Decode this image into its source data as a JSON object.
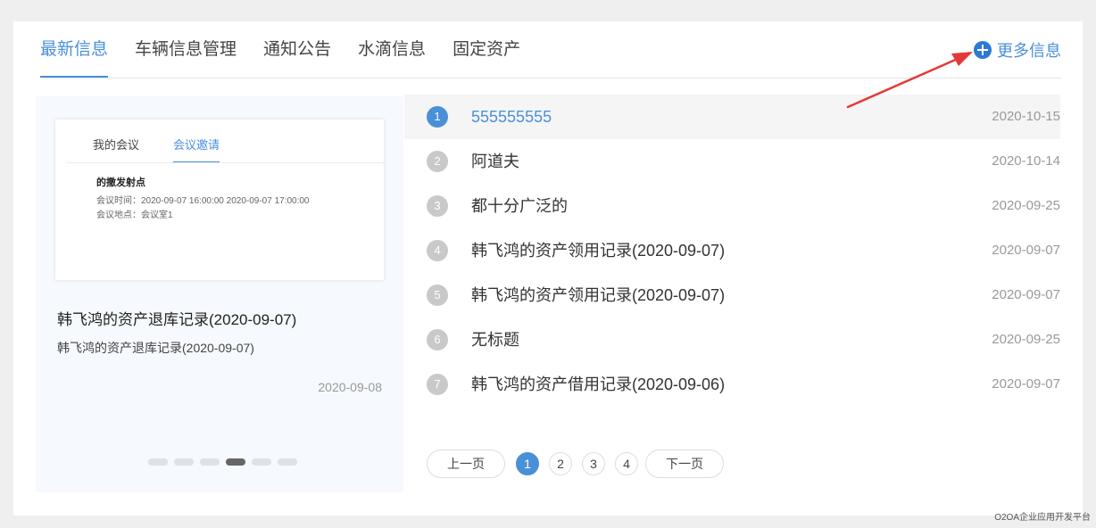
{
  "tabs": [
    {
      "label": "最新信息",
      "active": true
    },
    {
      "label": "车辆信息管理",
      "active": false
    },
    {
      "label": "通知公告",
      "active": false
    },
    {
      "label": "水滴信息",
      "active": false
    },
    {
      "label": "固定资产",
      "active": false
    }
  ],
  "more_label": "更多信息",
  "featured": {
    "preview": {
      "tab_my": "我的会议",
      "tab_invite": "会议邀请",
      "title": "的撒发射点",
      "time": "会议时间：2020-09-07 16:00:00 2020-09-07 17:00:00",
      "place": "会议地点：会议室1"
    },
    "title": "韩飞鸿的资产退库记录(2020-09-07)",
    "subtitle": "韩飞鸿的资产退库记录(2020-09-07)",
    "date": "2020-09-08",
    "slide_count": 6,
    "active_slide": 4
  },
  "items": [
    {
      "num": "1",
      "title": "555555555",
      "date": "2020-10-15"
    },
    {
      "num": "2",
      "title": "阿道夫",
      "date": "2020-10-14"
    },
    {
      "num": "3",
      "title": "都十分广泛的",
      "date": "2020-09-25"
    },
    {
      "num": "4",
      "title": "韩飞鸿的资产领用记录(2020-09-07)",
      "date": "2020-09-07"
    },
    {
      "num": "5",
      "title": "韩飞鸿的资产领用记录(2020-09-07)",
      "date": "2020-09-07"
    },
    {
      "num": "6",
      "title": "无标题",
      "date": "2020-09-25"
    },
    {
      "num": "7",
      "title": "韩飞鸿的资产借用记录(2020-09-06)",
      "date": "2020-09-07"
    }
  ],
  "pager": {
    "prev": "上一页",
    "next": "下一页",
    "pages": [
      "1",
      "2",
      "3",
      "4"
    ],
    "current": "1"
  },
  "watermark": "O2OA企业应用开发平台",
  "colors": {
    "accent": "#4a90d9",
    "arrow": "#e53935"
  }
}
